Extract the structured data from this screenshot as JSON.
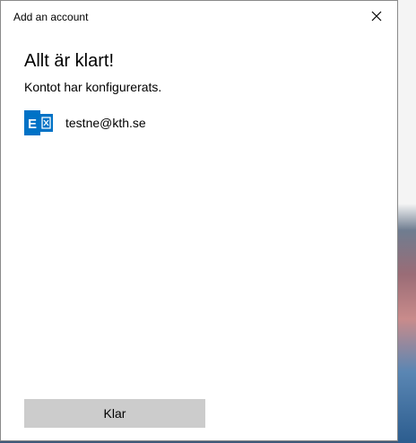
{
  "window": {
    "title": "Add an account"
  },
  "main": {
    "heading": "Allt är klart!",
    "subtext": "Kontot har konfigurerats."
  },
  "account": {
    "icon": "exchange-icon",
    "email": "testne@kth.se"
  },
  "footer": {
    "done_label": "Klar"
  },
  "colors": {
    "exchange_blue": "#0072c6",
    "button_gray": "#cccccc"
  }
}
